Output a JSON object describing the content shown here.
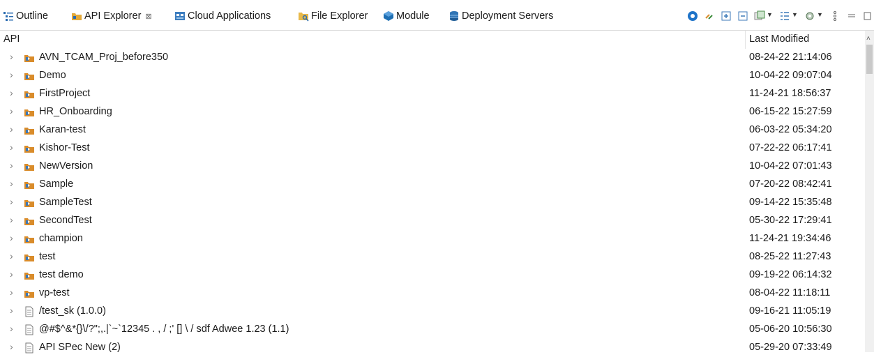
{
  "tabs": [
    {
      "label": "Outline",
      "icon": "outline-icon"
    },
    {
      "label": "API Explorer",
      "icon": "api-explorer-icon",
      "close": "⊠"
    },
    {
      "label": "Cloud Applications",
      "icon": "cloud-applications-icon"
    },
    {
      "label": "File Explorer",
      "icon": "file-explorer-icon"
    },
    {
      "label": "Module",
      "icon": "module-icon"
    },
    {
      "label": "Deployment Servers",
      "icon": "deployment-servers-icon"
    }
  ],
  "columns": {
    "api": "API",
    "modified": "Last Modified"
  },
  "rows": [
    {
      "name": "AVN_TCAM_Proj_before350",
      "date": "08-24-22 21:14:06",
      "type": "project"
    },
    {
      "name": "Demo",
      "date": "10-04-22 09:07:04",
      "type": "project"
    },
    {
      "name": "FirstProject",
      "date": "11-24-21 18:56:37",
      "type": "project"
    },
    {
      "name": "HR_Onboarding",
      "date": "06-15-22 15:27:59",
      "type": "project"
    },
    {
      "name": "Karan-test",
      "date": "06-03-22 05:34:20",
      "type": "project"
    },
    {
      "name": "Kishor-Test",
      "date": "07-22-22 06:17:41",
      "type": "project"
    },
    {
      "name": "NewVersion",
      "date": "10-04-22 07:01:43",
      "type": "project"
    },
    {
      "name": "Sample",
      "date": "07-20-22 08:42:41",
      "type": "project"
    },
    {
      "name": "SampleTest",
      "date": "09-14-22 15:35:48",
      "type": "project"
    },
    {
      "name": "SecondTest",
      "date": "05-30-22 17:29:41",
      "type": "project"
    },
    {
      "name": "champion",
      "date": "11-24-21 19:34:46",
      "type": "project"
    },
    {
      "name": "test",
      "date": "08-25-22 11:27:43",
      "type": "project"
    },
    {
      "name": "test demo",
      "date": "09-19-22 06:14:32",
      "type": "project"
    },
    {
      "name": "vp-test",
      "date": "08-04-22 11:18:11",
      "type": "project"
    },
    {
      "name": "/test_sk (1.0.0)",
      "date": "09-16-21 11:05:19",
      "type": "document"
    },
    {
      "name": "@#$^&*{}\\/?\";,.|`~`12345  . , / ;' [] \\ / sdf Adwee 1.23 (1.1)",
      "date": "05-06-20 10:56:30",
      "type": "document"
    },
    {
      "name": "API SPec New (2)",
      "date": "05-29-20 07:33:49",
      "type": "document"
    }
  ],
  "colors": {
    "accent": "#1e73c8",
    "project_icon": "#d98c2b",
    "header_sep": "#e4e4e4"
  }
}
